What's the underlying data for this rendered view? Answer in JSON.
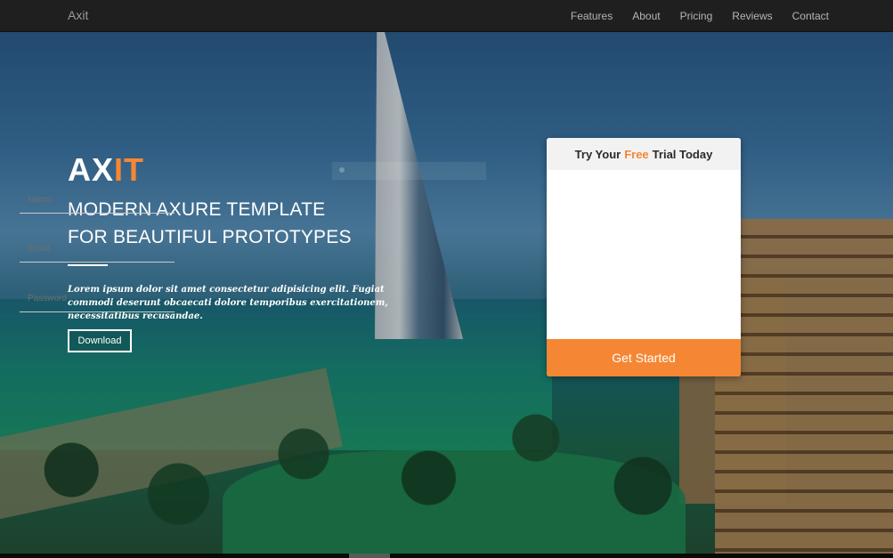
{
  "nav": {
    "brand": "Axit",
    "items": [
      {
        "label": "Features"
      },
      {
        "label": "About"
      },
      {
        "label": "Pricing"
      },
      {
        "label": "Reviews"
      },
      {
        "label": "Contact"
      }
    ]
  },
  "hero": {
    "logo_part1": "AX",
    "logo_part2": "IT",
    "headline_line1": "MODERN AXURE TEMPLATE",
    "headline_line2": "FOR BEAUTIFUL PROTOTYPES",
    "lede": "Lorem ipsum dolor sit amet consectetur adipisicing elit. Fugiat commodi deserunt obcaecati dolore temporibus exercitationem, necessitatibus recusandae.",
    "download_label": "Download"
  },
  "signup": {
    "title_before": "Try Your",
    "title_free": "Free",
    "title_after": "Trial Today",
    "name_placeholder": "Name",
    "email_placeholder": "Email",
    "password_placeholder": "Password",
    "cta_label": "Get Started"
  },
  "colors": {
    "accent": "#f58734",
    "nav_bg": "#1f1f1f"
  }
}
